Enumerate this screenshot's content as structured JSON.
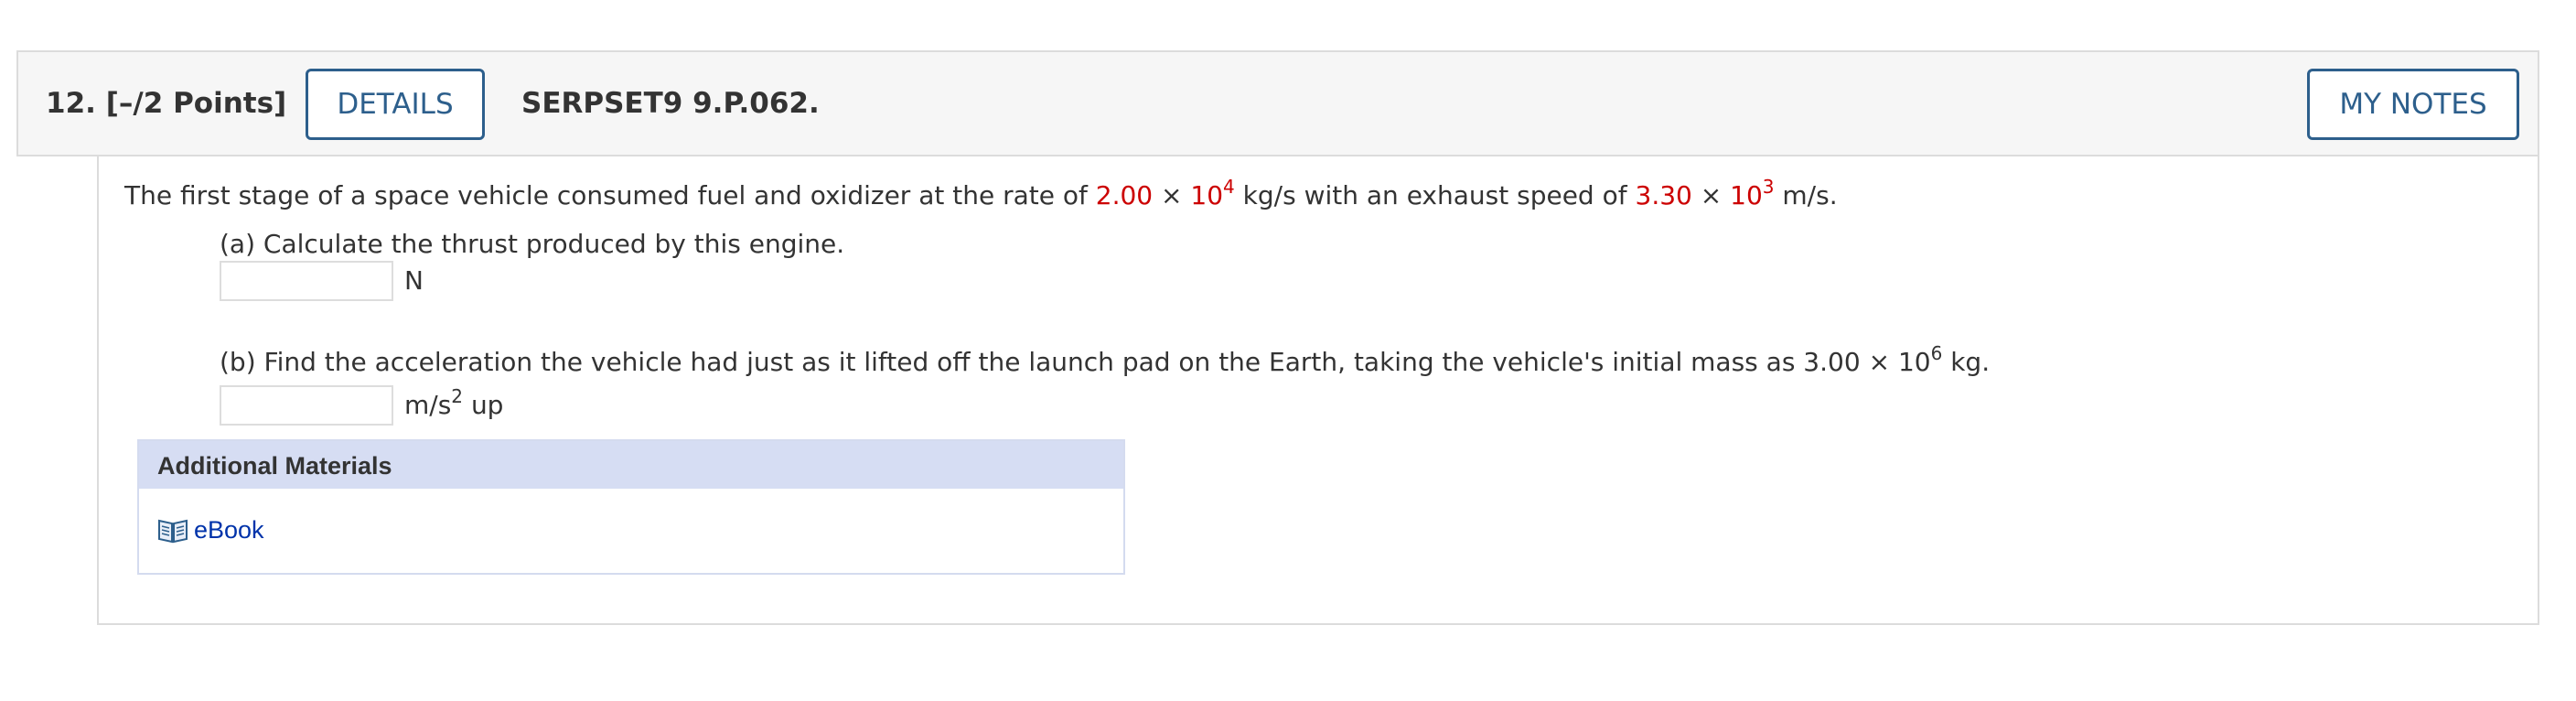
{
  "question": {
    "number": "12.",
    "points": "[–/2 Points]",
    "details_label": "DETAILS",
    "assignment_code": "SERPSET9 9.P.062.",
    "my_notes_label": "MY NOTES"
  },
  "problem": {
    "intro": "The first stage of a space vehicle consumed fuel and oxidizer at the rate of",
    "rate_mantissa": "2.00",
    "times": "×",
    "rate_base": "10",
    "rate_exponent": "4",
    "rate_unit_text": "kg/s with an exhaust speed of",
    "speed_mantissa": "3.30",
    "speed_base": "10",
    "speed_exponent": "3",
    "speed_unit": "m/s."
  },
  "parts": [
    {
      "prompt": "(a) Calculate the thrust produced by this engine.",
      "unit": "N"
    },
    {
      "prompt_prefix": "(b) Find the acceleration the vehicle had just as it lifted off the launch pad on the Earth, taking the vehicle's initial mass as 3.00",
      "times": "×",
      "base": "10",
      "exponent": "6",
      "prompt_suffix": "kg.",
      "unit_prefix": "m/s",
      "unit_exponent": "2",
      "unit_suffix": "up"
    }
  ],
  "additional_materials": {
    "title": "Additional Materials",
    "links": [
      {
        "label": "eBook",
        "icon": "book-icon"
      }
    ]
  },
  "colors": {
    "accent": "#2d5f8c",
    "given_value": "#cc0000",
    "materials_header_bg": "#d6ddf3",
    "link": "#0033aa"
  }
}
